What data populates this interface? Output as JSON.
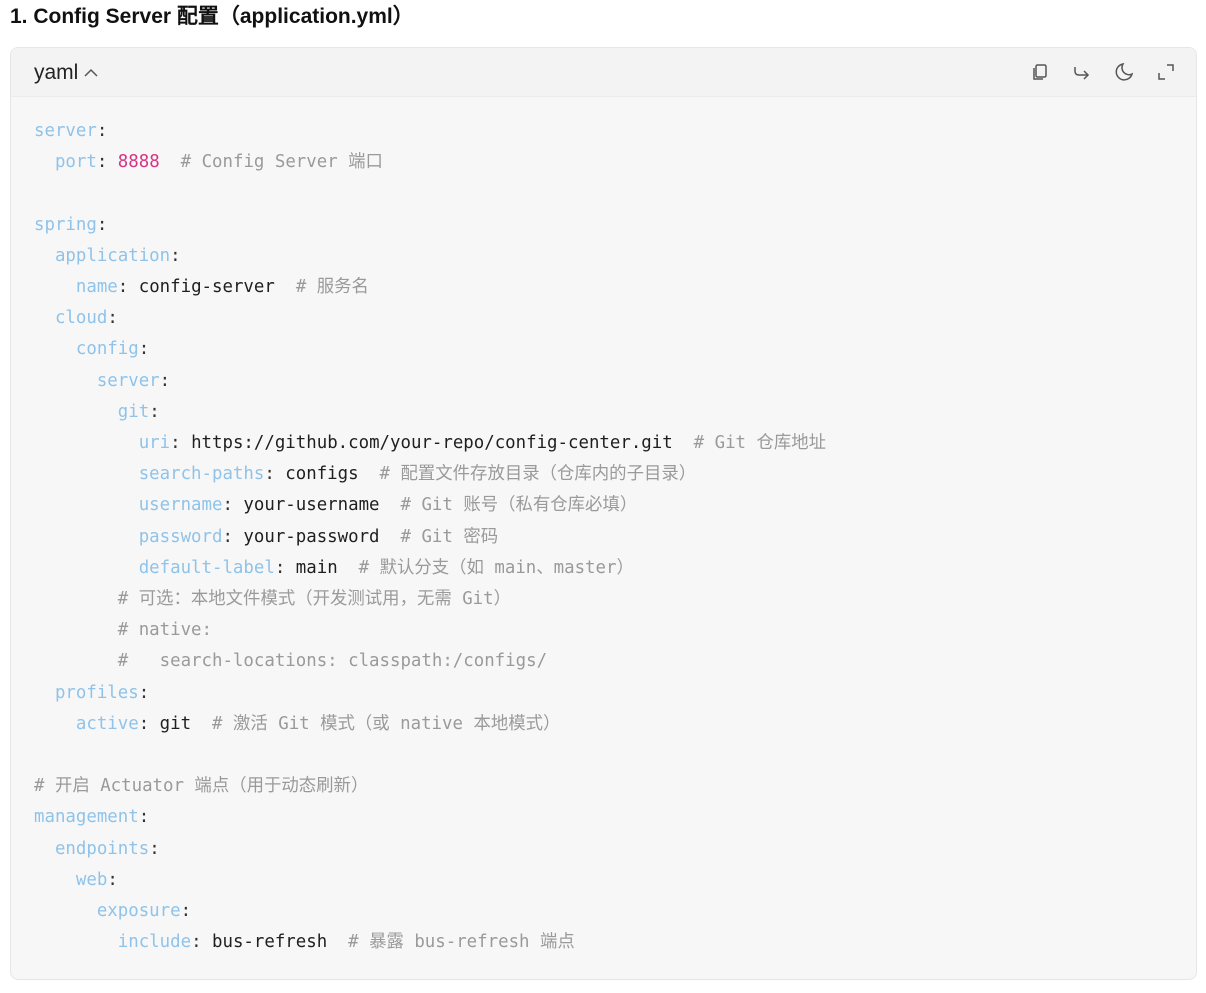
{
  "heading": "1. Config Server 配置（application.yml）",
  "code_block": {
    "language": "yaml",
    "toolbar": [
      "copy-icon",
      "share-icon",
      "theme-moon-icon",
      "expand-icon"
    ],
    "colors": {
      "key": "#8fc3e9",
      "number": "#d63384",
      "comment": "#9a9a9a",
      "value": "#1f1f1f"
    },
    "lines": [
      [
        {
          "t": "k",
          "s": "server"
        },
        {
          "t": "p",
          "s": ":"
        }
      ],
      [
        {
          "t": "p",
          "s": "  "
        },
        {
          "t": "k",
          "s": "port"
        },
        {
          "t": "p",
          "s": ": "
        },
        {
          "t": "n",
          "s": "8888"
        },
        {
          "t": "p",
          "s": "  "
        },
        {
          "t": "c",
          "s": "# Config Server 端口"
        }
      ],
      [],
      [
        {
          "t": "k",
          "s": "spring"
        },
        {
          "t": "p",
          "s": ":"
        }
      ],
      [
        {
          "t": "p",
          "s": "  "
        },
        {
          "t": "k",
          "s": "application"
        },
        {
          "t": "p",
          "s": ":"
        }
      ],
      [
        {
          "t": "p",
          "s": "    "
        },
        {
          "t": "k",
          "s": "name"
        },
        {
          "t": "p",
          "s": ": "
        },
        {
          "t": "v",
          "s": "config-server"
        },
        {
          "t": "p",
          "s": "  "
        },
        {
          "t": "c",
          "s": "# 服务名"
        }
      ],
      [
        {
          "t": "p",
          "s": "  "
        },
        {
          "t": "k",
          "s": "cloud"
        },
        {
          "t": "p",
          "s": ":"
        }
      ],
      [
        {
          "t": "p",
          "s": "    "
        },
        {
          "t": "k",
          "s": "config"
        },
        {
          "t": "p",
          "s": ":"
        }
      ],
      [
        {
          "t": "p",
          "s": "      "
        },
        {
          "t": "k",
          "s": "server"
        },
        {
          "t": "p",
          "s": ":"
        }
      ],
      [
        {
          "t": "p",
          "s": "        "
        },
        {
          "t": "k",
          "s": "git"
        },
        {
          "t": "p",
          "s": ":"
        }
      ],
      [
        {
          "t": "p",
          "s": "          "
        },
        {
          "t": "k",
          "s": "uri"
        },
        {
          "t": "p",
          "s": ": "
        },
        {
          "t": "v",
          "s": "https://github.com/your-repo/config-center.git"
        },
        {
          "t": "p",
          "s": "  "
        },
        {
          "t": "c",
          "s": "# Git 仓库地址"
        }
      ],
      [
        {
          "t": "p",
          "s": "          "
        },
        {
          "t": "k",
          "s": "search-paths"
        },
        {
          "t": "p",
          "s": ": "
        },
        {
          "t": "v",
          "s": "configs"
        },
        {
          "t": "p",
          "s": "  "
        },
        {
          "t": "c",
          "s": "# 配置文件存放目录（仓库内的子目录）"
        }
      ],
      [
        {
          "t": "p",
          "s": "          "
        },
        {
          "t": "k",
          "s": "username"
        },
        {
          "t": "p",
          "s": ": "
        },
        {
          "t": "v",
          "s": "your-username"
        },
        {
          "t": "p",
          "s": "  "
        },
        {
          "t": "c",
          "s": "# Git 账号（私有仓库必填）"
        }
      ],
      [
        {
          "t": "p",
          "s": "          "
        },
        {
          "t": "k",
          "s": "password"
        },
        {
          "t": "p",
          "s": ": "
        },
        {
          "t": "v",
          "s": "your-password"
        },
        {
          "t": "p",
          "s": "  "
        },
        {
          "t": "c",
          "s": "# Git 密码"
        }
      ],
      [
        {
          "t": "p",
          "s": "          "
        },
        {
          "t": "k",
          "s": "default-label"
        },
        {
          "t": "p",
          "s": ": "
        },
        {
          "t": "v",
          "s": "main"
        },
        {
          "t": "p",
          "s": "  "
        },
        {
          "t": "c",
          "s": "# 默认分支（如 main、master）"
        }
      ],
      [
        {
          "t": "p",
          "s": "        "
        },
        {
          "t": "c",
          "s": "# 可选：本地文件模式（开发测试用，无需 Git）"
        }
      ],
      [
        {
          "t": "p",
          "s": "        "
        },
        {
          "t": "c",
          "s": "# native:"
        }
      ],
      [
        {
          "t": "p",
          "s": "        "
        },
        {
          "t": "c",
          "s": "#   search-locations: classpath:/configs/"
        }
      ],
      [
        {
          "t": "p",
          "s": "  "
        },
        {
          "t": "k",
          "s": "profiles"
        },
        {
          "t": "p",
          "s": ":"
        }
      ],
      [
        {
          "t": "p",
          "s": "    "
        },
        {
          "t": "k",
          "s": "active"
        },
        {
          "t": "p",
          "s": ": "
        },
        {
          "t": "v",
          "s": "git"
        },
        {
          "t": "p",
          "s": "  "
        },
        {
          "t": "c",
          "s": "# 激活 Git 模式（或 native 本地模式）"
        }
      ],
      [],
      [
        {
          "t": "c",
          "s": "# 开启 Actuator 端点（用于动态刷新）"
        }
      ],
      [
        {
          "t": "k",
          "s": "management"
        },
        {
          "t": "p",
          "s": ":"
        }
      ],
      [
        {
          "t": "p",
          "s": "  "
        },
        {
          "t": "k",
          "s": "endpoints"
        },
        {
          "t": "p",
          "s": ":"
        }
      ],
      [
        {
          "t": "p",
          "s": "    "
        },
        {
          "t": "k",
          "s": "web"
        },
        {
          "t": "p",
          "s": ":"
        }
      ],
      [
        {
          "t": "p",
          "s": "      "
        },
        {
          "t": "k",
          "s": "exposure"
        },
        {
          "t": "p",
          "s": ":"
        }
      ],
      [
        {
          "t": "p",
          "s": "        "
        },
        {
          "t": "k",
          "s": "include"
        },
        {
          "t": "p",
          "s": ": "
        },
        {
          "t": "v",
          "s": "bus-refresh"
        },
        {
          "t": "p",
          "s": "  "
        },
        {
          "t": "c",
          "s": "# 暴露 bus-refresh 端点"
        }
      ]
    ]
  }
}
